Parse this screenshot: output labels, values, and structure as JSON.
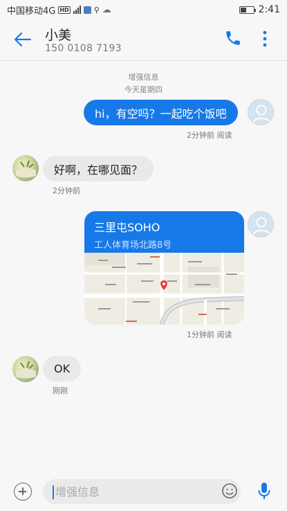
{
  "status_bar": {
    "carrier": "中国移动4G",
    "hd": "HD",
    "time": "2:41"
  },
  "header": {
    "contact_name": "小美",
    "contact_number": "150 0108 7193"
  },
  "conversation": {
    "system_label": "增强信息",
    "date_label": "今天星期四",
    "messages": [
      {
        "direction": "out",
        "text": "hi，有空吗？一起吃个饭吧",
        "meta": "2分钟前 阅读"
      },
      {
        "direction": "in",
        "text": "好啊，在哪见面？",
        "meta": "2分钟前"
      },
      {
        "direction": "out",
        "type": "location",
        "title": "三里屯SOHO",
        "address": "工人体育场北路8号",
        "meta": "1分钟前 阅读"
      },
      {
        "direction": "in",
        "text": "OK",
        "meta": "刚刚"
      }
    ]
  },
  "input": {
    "placeholder": "增强信息"
  },
  "icons": {
    "back": "back-arrow-icon",
    "call": "phone-icon",
    "more": "more-vert-icon",
    "add": "plus-icon",
    "emoji": "emoji-icon",
    "mic": "microphone-icon"
  },
  "colors": {
    "accent": "#1779e8",
    "incoming_bubble": "#e9e9e9"
  }
}
